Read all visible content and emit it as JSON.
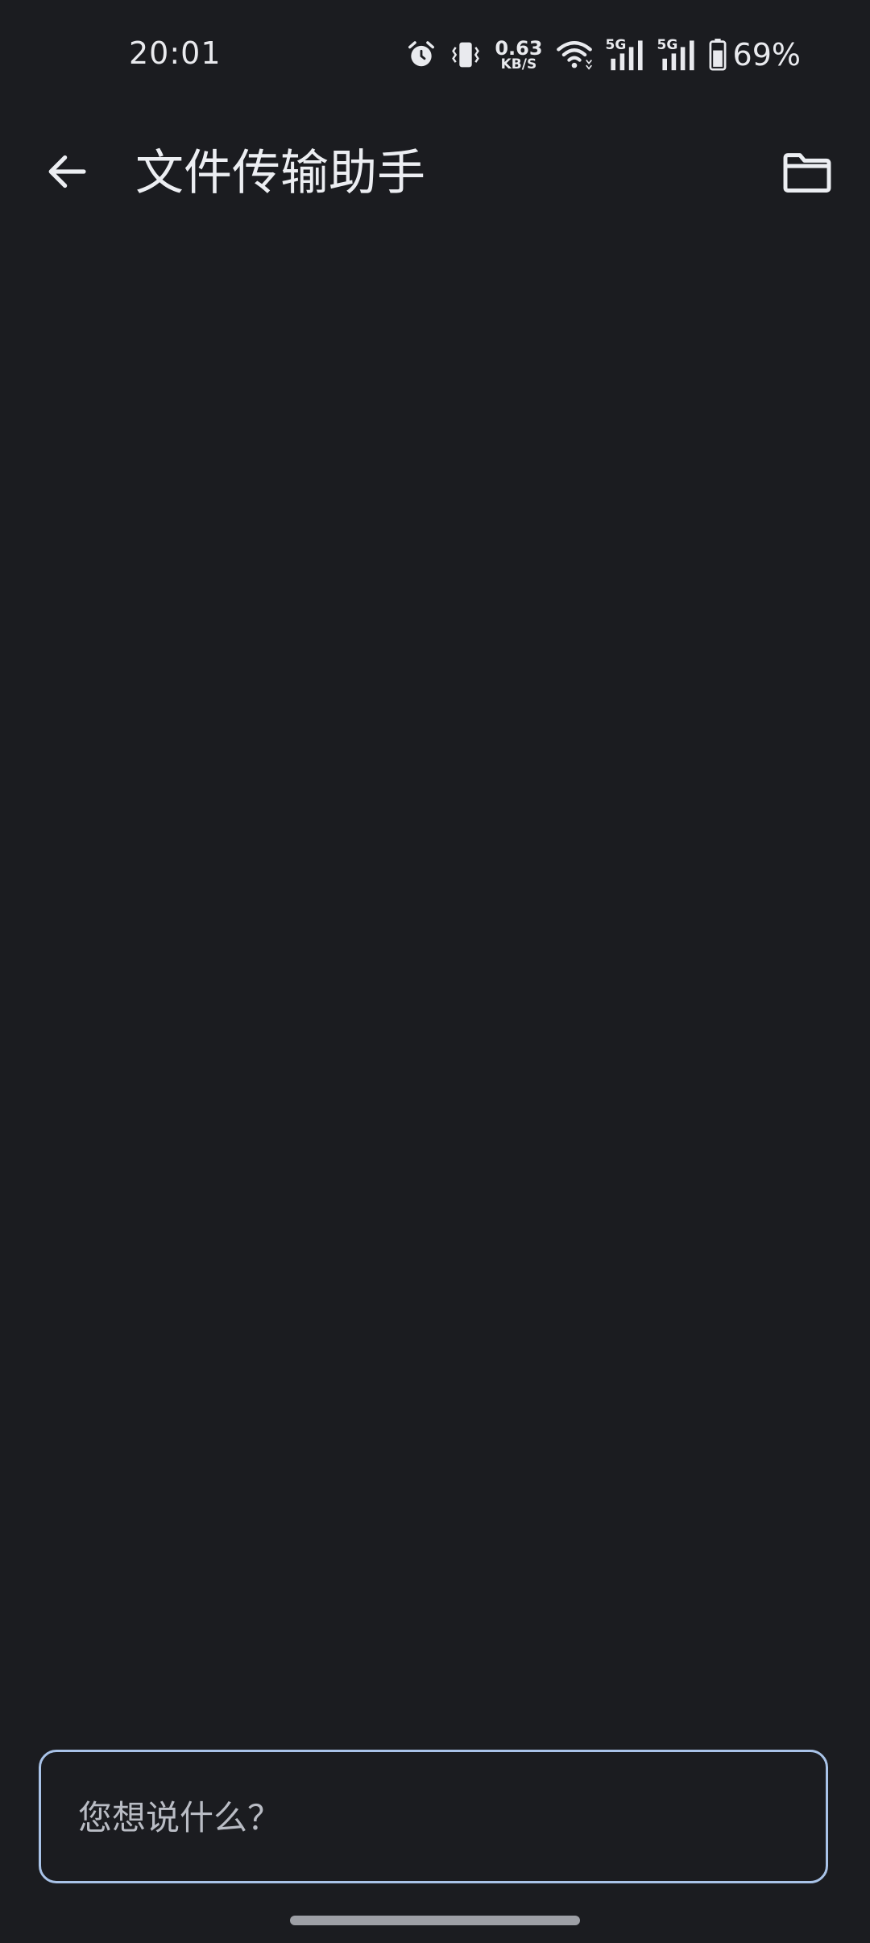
{
  "status_bar": {
    "time": "20:01",
    "net_speed_value": "0.63",
    "net_speed_unit": "KB/S",
    "sim1_generation": "5G",
    "sim2_generation": "5G",
    "battery_percent": "69%",
    "icons": [
      "alarm-icon",
      "vibrate-icon",
      "wifi-icon",
      "signal-icon",
      "signal-icon",
      "battery-icon"
    ]
  },
  "app_bar": {
    "title": "文件传输助手",
    "back_icon": "arrow-left-icon",
    "folder_icon": "folder-icon"
  },
  "composer": {
    "placeholder": "您想说什么？",
    "value": ""
  },
  "colors": {
    "background": "#1b1c20",
    "foreground": "#e9eaee",
    "input_border": "#a9c3e8",
    "gesture_bar": "#9ea0a6"
  }
}
